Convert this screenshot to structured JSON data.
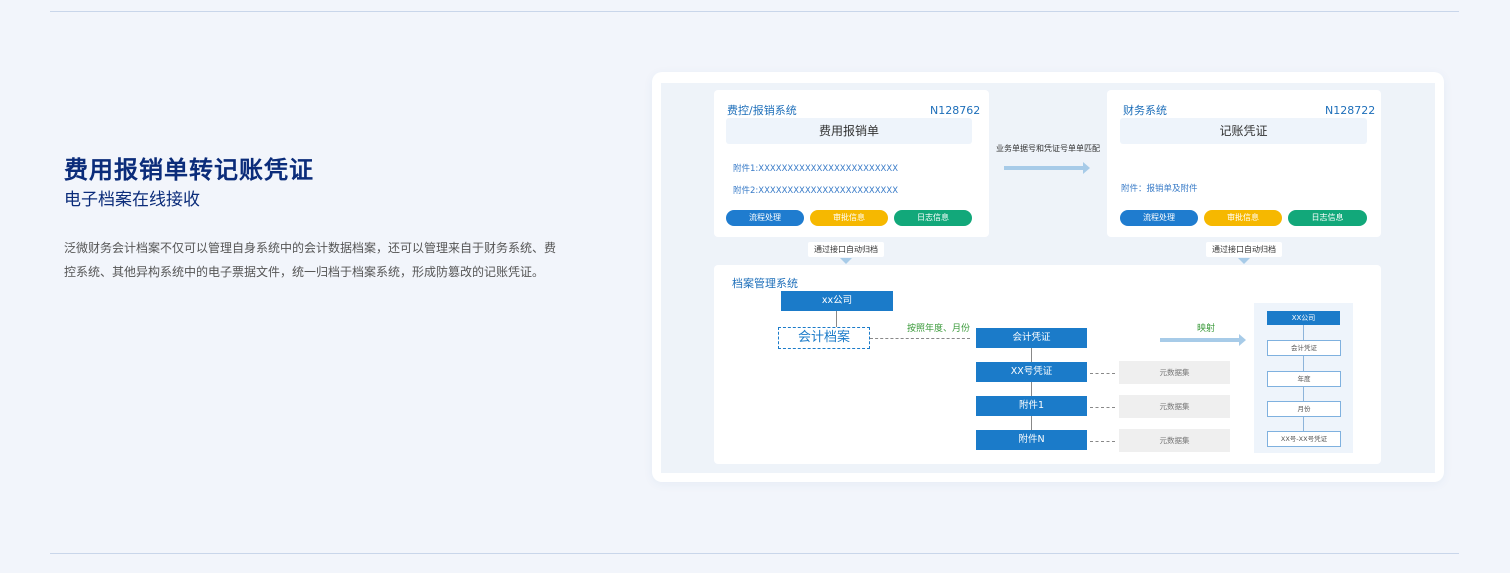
{
  "intro": {
    "title": "费用报销单转记账凭证",
    "subtitle": "电子档案在线接收",
    "description": "泛微财务会计档案不仅可以管理自身系统中的会计数据档案，还可以管理来自于财务系统、费控系统、其他异构系统中的电子票据文件，统一归档于档案系统，形成防篡改的记账凭证。"
  },
  "diagram": {
    "expense_system": {
      "title": "费控/报销系统",
      "number": "N128762",
      "document": "费用报销单",
      "attachments": [
        "附件1:XXXXXXXXXXXXXXXXXXXXXXXX",
        "附件2:XXXXXXXXXXXXXXXXXXXXXXXX"
      ],
      "buttons": [
        "流程处理",
        "审批信息",
        "日志信息"
      ]
    },
    "match_label": "业务单据号和凭证号单单匹配",
    "finance_system": {
      "title": "财务系统",
      "number": "N128722",
      "document": "记账凭证",
      "attachments_note": "附件：报销单及附件",
      "buttons": [
        "流程处理",
        "审批信息",
        "日志信息"
      ]
    },
    "auto_archive_left": "通过接口自动归档",
    "auto_archive_right": "通过接口自动归档",
    "archive_system": {
      "title": "档案管理系统",
      "company": "xx公司",
      "archive": "会计档案",
      "by_period": "按照年度、月份",
      "voucher": "会计凭证",
      "voucher_no": "XX号凭证",
      "attachment1": "附件1",
      "attachmentN": "附件N",
      "metadata": [
        "元数据集",
        "元数据集",
        "元数据集"
      ],
      "mapping_label": "映射",
      "mapping": {
        "company": "XX公司",
        "items": [
          "会计凭证",
          "年度",
          "月份",
          "XX号-XX号凭证"
        ]
      }
    }
  },
  "colors": {
    "brand_dark": "#0b2c7a",
    "primary": "#1b7bc9",
    "yellow": "#f6b800",
    "green": "#12a87a"
  }
}
